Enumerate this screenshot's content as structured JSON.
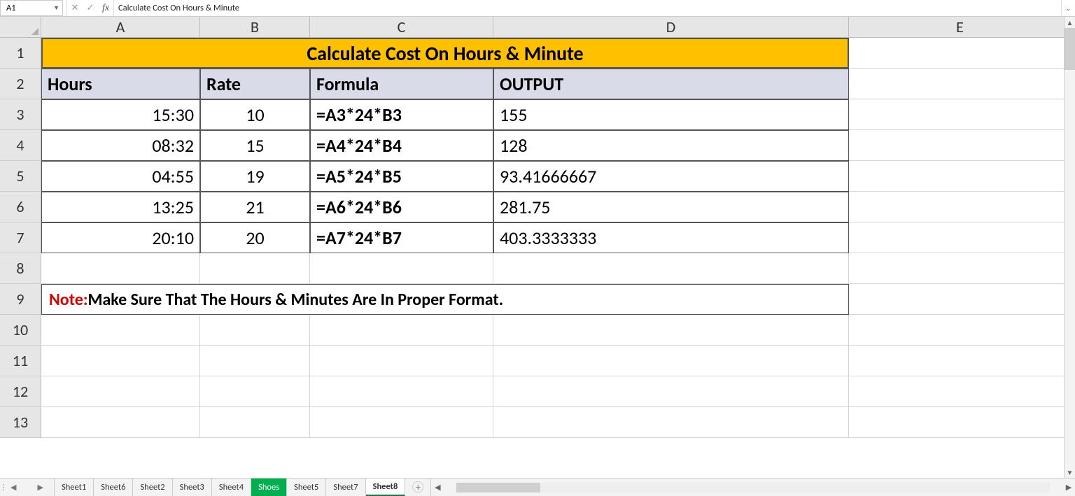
{
  "formula_bar": {
    "name_box": "A1",
    "content": "Calculate Cost On Hours & Minute"
  },
  "columns": [
    "A",
    "B",
    "C",
    "D",
    "E"
  ],
  "row_numbers": [
    "1",
    "2",
    "3",
    "4",
    "5",
    "6",
    "7",
    "8",
    "9",
    "10",
    "11",
    "12",
    "13"
  ],
  "title": "Calculate Cost On Hours & Minute",
  "headers": {
    "a": "Hours",
    "b": "Rate",
    "c": "Formula",
    "d": "OUTPUT"
  },
  "data_rows": [
    {
      "hours": "15:30",
      "rate": "10",
      "formula": "=A3*24*B3",
      "output": "155"
    },
    {
      "hours": "08:32",
      "rate": "15",
      "formula": "=A4*24*B4",
      "output": "128"
    },
    {
      "hours": "04:55",
      "rate": "19",
      "formula": "=A5*24*B5",
      "output": "93.41666667"
    },
    {
      "hours": "13:25",
      "rate": "21",
      "formula": "=A6*24*B6",
      "output": "281.75"
    },
    {
      "hours": "20:10",
      "rate": "20",
      "formula": "=A7*24*B7",
      "output": "403.3333333"
    }
  ],
  "note_prefix": "Note:",
  "note_text": " Make Sure That The Hours & Minutes Are In Proper Format.",
  "sheet_tabs": [
    "Sheet1",
    "Sheet6",
    "Sheet2",
    "Sheet3",
    "Sheet4",
    "Shoes",
    "Sheet5",
    "Sheet7",
    "Sheet8"
  ],
  "active_tab": "Sheet8",
  "green_tab": "Shoes"
}
